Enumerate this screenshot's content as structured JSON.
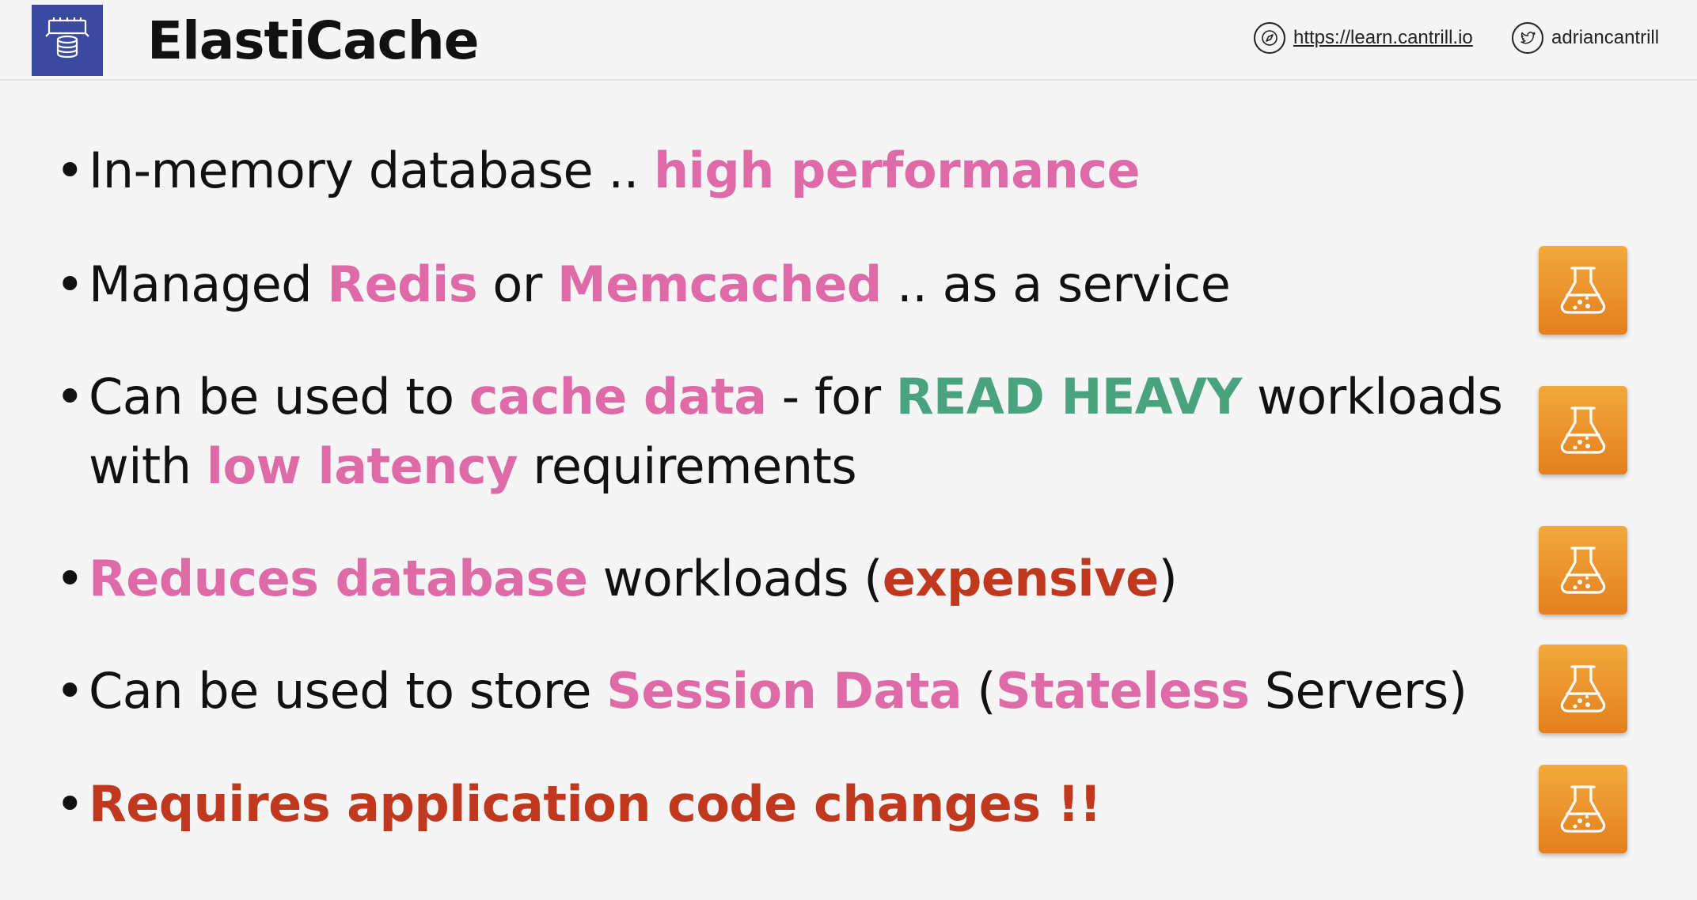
{
  "header": {
    "title": "ElastiCache",
    "logo_icon": "elasticache-database-icon",
    "link_text": "https://learn.cantrill.io",
    "twitter_handle": "adriancantrill"
  },
  "bullets": [
    {
      "parts": [
        {
          "text": "In-memory database .. ",
          "style": "plain"
        },
        {
          "text": "high performance",
          "style": "pink"
        }
      ]
    },
    {
      "parts": [
        {
          "text": "Managed ",
          "style": "plain"
        },
        {
          "text": "Redis",
          "style": "pink"
        },
        {
          "text": " or ",
          "style": "plain"
        },
        {
          "text": "Memcached",
          "style": "pink"
        },
        {
          "text": " .. as a service",
          "style": "plain"
        }
      ]
    },
    {
      "parts": [
        {
          "text": "Can be used to ",
          "style": "plain"
        },
        {
          "text": "cache data",
          "style": "pink"
        },
        {
          "text": " - for ",
          "style": "plain"
        },
        {
          "text": "READ HEAVY",
          "style": "green"
        },
        {
          "text": " workloads",
          "style": "plain"
        }
      ],
      "line2": [
        {
          "text": "with ",
          "style": "plain"
        },
        {
          "text": "low latency",
          "style": "pink"
        },
        {
          "text": " requirements",
          "style": "plain"
        }
      ]
    },
    {
      "parts": [
        {
          "text": "Reduces database",
          "style": "pink"
        },
        {
          "text": " workloads (",
          "style": "plain"
        },
        {
          "text": "expensive",
          "style": "red"
        },
        {
          "text": ")",
          "style": "plain"
        }
      ]
    },
    {
      "parts": [
        {
          "text": "Can be used to store ",
          "style": "plain"
        },
        {
          "text": "Session Data",
          "style": "pink"
        },
        {
          "text": " (",
          "style": "plain"
        },
        {
          "text": "Stateless",
          "style": "pink"
        },
        {
          "text": " Servers)",
          "style": "plain"
        }
      ]
    },
    {
      "parts": [
        {
          "text": "Requires application code changes !!",
          "style": "red"
        }
      ]
    }
  ],
  "colors": {
    "pink": "#de6aa7",
    "green": "#4aa37f",
    "red": "#c0391f",
    "lab_orange": "#e9901f"
  },
  "lab_icons": [
    "lab-flask-icon",
    "lab-flask-icon",
    "lab-flask-icon",
    "lab-flask-icon",
    "lab-flask-icon"
  ]
}
